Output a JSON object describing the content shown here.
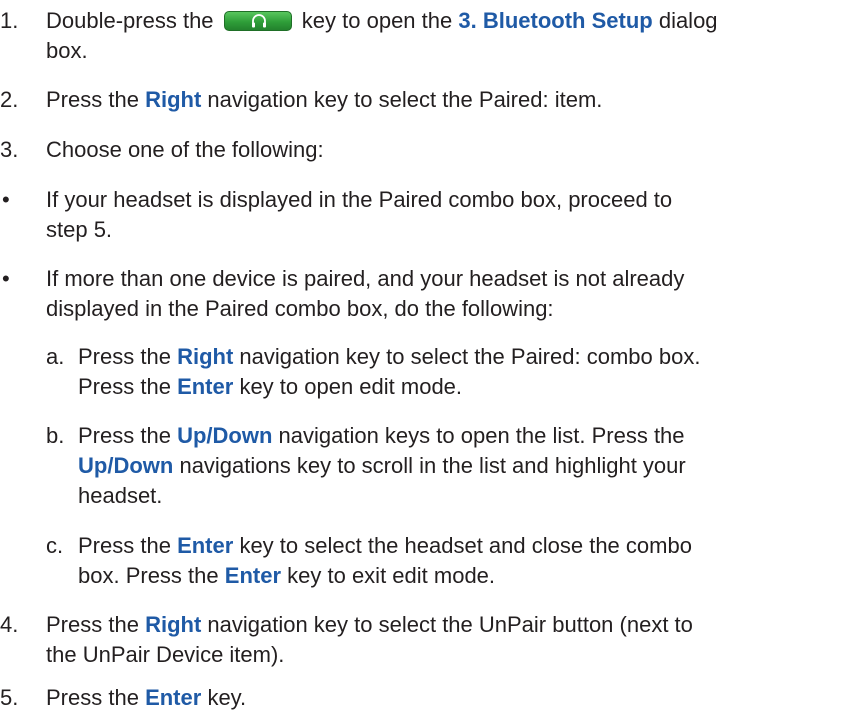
{
  "steps": {
    "s1": {
      "num": "1.",
      "pre": "Double-press the",
      "key_icon": "headset-icon",
      "mid": "key to open the",
      "link": "3. Bluetooth Setup",
      "post": "dialog",
      "line2": "box."
    },
    "s2": {
      "num": "2.",
      "pre": "Press the",
      "kw": "Right",
      "post": "navigation key to select the Paired: item."
    },
    "s3": {
      "num": "3.",
      "text": "Choose one of the following:"
    },
    "b1": {
      "bullet": "•",
      "line1": "If your headset is displayed in the Paired combo box, proceed to",
      "line2": "step 5."
    },
    "b2": {
      "bullet": "•",
      "line1": "If more than one device is paired, and your headset is not already",
      "line2": "displayed in the Paired combo box, do the following:"
    },
    "sa": {
      "num": "a.",
      "l1_pre": "Press the",
      "l1_kw": "Right",
      "l1_post": "navigation key to select the Paired: combo box.",
      "l2_pre": "Press the",
      "l2_kw": "Enter",
      "l2_post": "key to open edit mode."
    },
    "sb": {
      "num": "b.",
      "l1_pre": "Press the",
      "l1_kw": "Up/Down",
      "l1_post": "navigation keys to open the list. Press the",
      "l2_kw": "Up/Down",
      "l2_post": "navigations key to scroll in the list and highlight your",
      "l3": "headset."
    },
    "sc": {
      "num": "c.",
      "l1_pre": "Press the",
      "l1_kw": "Enter",
      "l1_post": "key to select the headset and close the combo",
      "l2_pre": "box. Press the",
      "l2_kw": "Enter",
      "l2_post": "key to exit edit mode."
    },
    "s4": {
      "num": "4.",
      "pre": "Press the",
      "kw": "Right",
      "post": "navigation key to select the UnPair button (next to",
      "line2": "the UnPair Device item)."
    },
    "s5": {
      "num": "5.",
      "pre": "Press the",
      "kw": "Enter",
      "post": "key."
    }
  },
  "colors": {
    "text": "#231f20",
    "keyword": "#1f5aa6",
    "key_button": "#2f9e39"
  }
}
